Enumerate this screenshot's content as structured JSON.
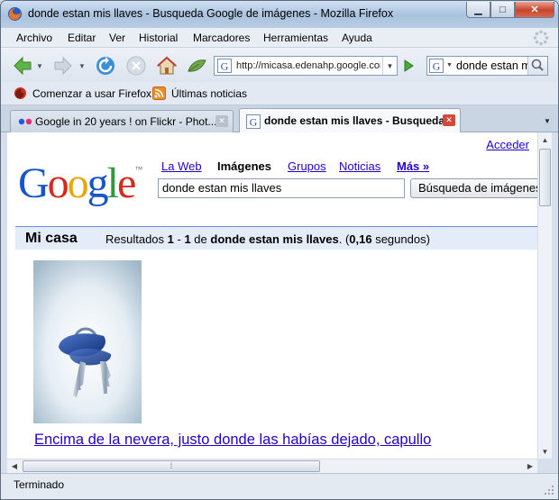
{
  "window": {
    "title": "donde estan mis llaves - Busqueda Google de imágenes - Mozilla Firefox"
  },
  "menu": [
    "Archivo",
    "Editar",
    "Ver",
    "Historial",
    "Marcadores",
    "Herramientas",
    "Ayuda"
  ],
  "nav": {
    "url": "http://micasa.edenahp.google.com",
    "search_value": "donde estan mis llaves"
  },
  "bookmarks": [
    "Comenzar a usar Firefox",
    "Últimas noticias"
  ],
  "tabs": [
    {
      "label": "Google in 20 years ! on Flickr - Phot...",
      "active": false
    },
    {
      "label": "donde estan mis llaves - Busqueda...",
      "active": true
    }
  ],
  "page": {
    "signin": "Acceder",
    "logo": "Google",
    "gtabs": [
      "La Web",
      "Imágenes",
      "Grupos",
      "Noticias",
      "Más »"
    ],
    "query": "donde estan mis llaves",
    "search_button": "Búsqueda de imágenes",
    "results_title": "Mi casa",
    "results_prefix": "Resultados ",
    "results_from": "1",
    "results_sep": " - ",
    "results_to": "1",
    "results_of": " de ",
    "results_query": "donde estan mis llaves",
    "results_open": ". (",
    "results_time": "0,16",
    "results_tail": " segundos)",
    "result_link": "Encima de la nevera, justo donde las habías dejado, capullo"
  },
  "status": "Terminado",
  "colors": {
    "link": "#2200cc",
    "results_bar": "#e5ecf9",
    "google_blue": "#1a55c8",
    "google_red": "#d52b1e",
    "google_yellow": "#e9a60c",
    "google_green": "#2b9a3d"
  }
}
